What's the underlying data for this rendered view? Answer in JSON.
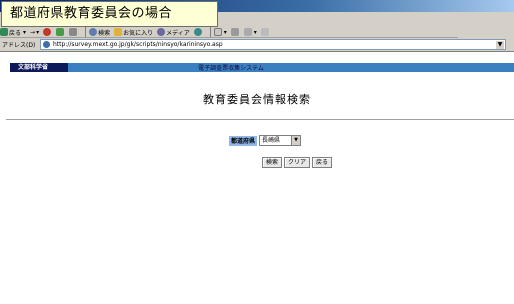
{
  "caption": "都道府県教育委員会の場合",
  "toolbar": {
    "back": "戻る",
    "search": "検索",
    "favorites": "お気に入り",
    "media": "メディア"
  },
  "address": {
    "label": "アドレス(D)",
    "url": "http://survey.mext.go.jp/gk/scripts/ninsyo/karininsyo.asp"
  },
  "page": {
    "org_label": "文部科学省",
    "system_title": "電子調査票収集システム",
    "title": "教育委員会情報検索",
    "prefecture_label": "都道府県",
    "prefecture_value": "長崎県",
    "search_button": "検索",
    "clear_button": "クリア",
    "back_button": "戻る"
  },
  "colors": {
    "system_bar": "#3a7fc0",
    "org_label_bg": "#0d1a5a",
    "pref_label_bg": "#8fb8e8",
    "caption_bg": "#ffffd6"
  }
}
